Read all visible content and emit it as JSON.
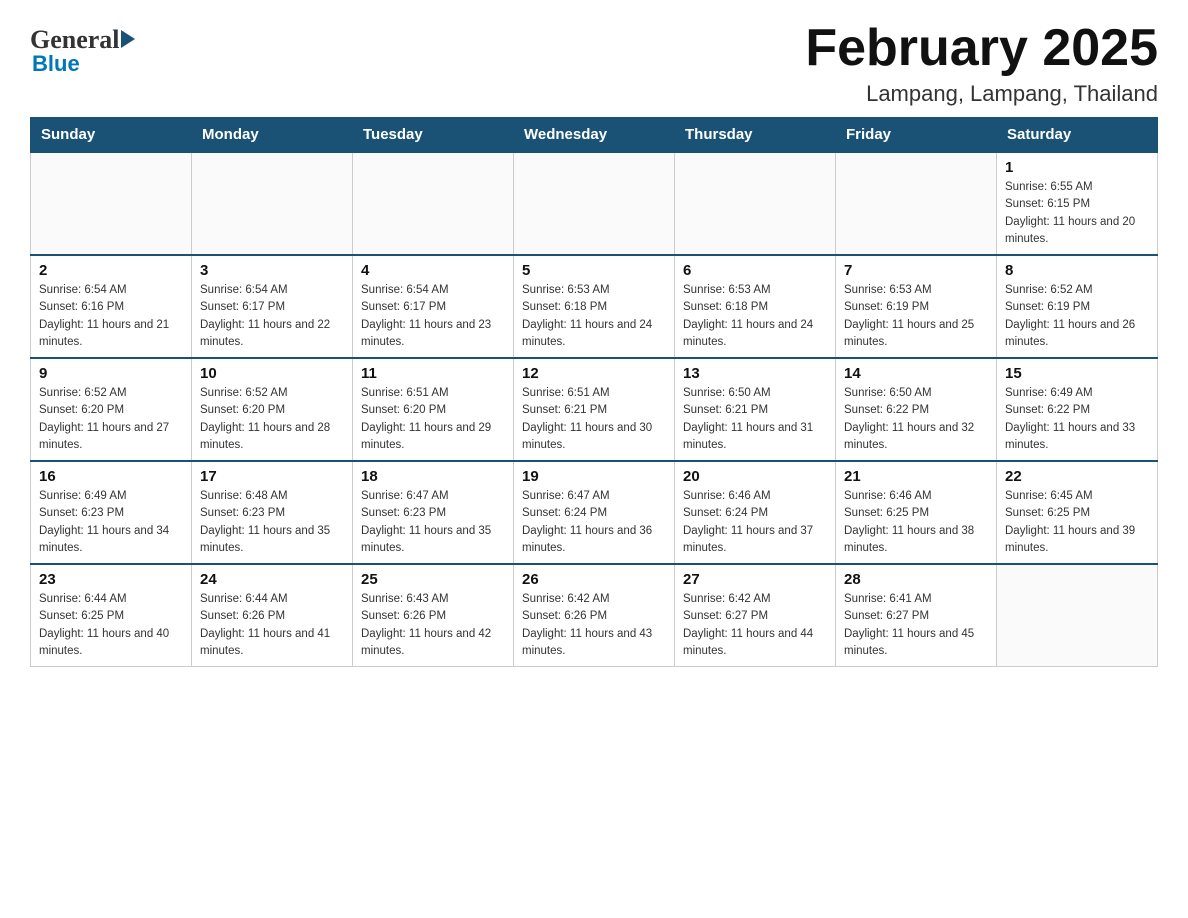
{
  "logo": {
    "general": "General",
    "blue": "Blue"
  },
  "title": "February 2025",
  "subtitle": "Lampang, Lampang, Thailand",
  "weekdays": [
    "Sunday",
    "Monday",
    "Tuesday",
    "Wednesday",
    "Thursday",
    "Friday",
    "Saturday"
  ],
  "weeks": [
    [
      {
        "day": "",
        "info": ""
      },
      {
        "day": "",
        "info": ""
      },
      {
        "day": "",
        "info": ""
      },
      {
        "day": "",
        "info": ""
      },
      {
        "day": "",
        "info": ""
      },
      {
        "day": "",
        "info": ""
      },
      {
        "day": "1",
        "info": "Sunrise: 6:55 AM\nSunset: 6:15 PM\nDaylight: 11 hours and 20 minutes."
      }
    ],
    [
      {
        "day": "2",
        "info": "Sunrise: 6:54 AM\nSunset: 6:16 PM\nDaylight: 11 hours and 21 minutes."
      },
      {
        "day": "3",
        "info": "Sunrise: 6:54 AM\nSunset: 6:17 PM\nDaylight: 11 hours and 22 minutes."
      },
      {
        "day": "4",
        "info": "Sunrise: 6:54 AM\nSunset: 6:17 PM\nDaylight: 11 hours and 23 minutes."
      },
      {
        "day": "5",
        "info": "Sunrise: 6:53 AM\nSunset: 6:18 PM\nDaylight: 11 hours and 24 minutes."
      },
      {
        "day": "6",
        "info": "Sunrise: 6:53 AM\nSunset: 6:18 PM\nDaylight: 11 hours and 24 minutes."
      },
      {
        "day": "7",
        "info": "Sunrise: 6:53 AM\nSunset: 6:19 PM\nDaylight: 11 hours and 25 minutes."
      },
      {
        "day": "8",
        "info": "Sunrise: 6:52 AM\nSunset: 6:19 PM\nDaylight: 11 hours and 26 minutes."
      }
    ],
    [
      {
        "day": "9",
        "info": "Sunrise: 6:52 AM\nSunset: 6:20 PM\nDaylight: 11 hours and 27 minutes."
      },
      {
        "day": "10",
        "info": "Sunrise: 6:52 AM\nSunset: 6:20 PM\nDaylight: 11 hours and 28 minutes."
      },
      {
        "day": "11",
        "info": "Sunrise: 6:51 AM\nSunset: 6:20 PM\nDaylight: 11 hours and 29 minutes."
      },
      {
        "day": "12",
        "info": "Sunrise: 6:51 AM\nSunset: 6:21 PM\nDaylight: 11 hours and 30 minutes."
      },
      {
        "day": "13",
        "info": "Sunrise: 6:50 AM\nSunset: 6:21 PM\nDaylight: 11 hours and 31 minutes."
      },
      {
        "day": "14",
        "info": "Sunrise: 6:50 AM\nSunset: 6:22 PM\nDaylight: 11 hours and 32 minutes."
      },
      {
        "day": "15",
        "info": "Sunrise: 6:49 AM\nSunset: 6:22 PM\nDaylight: 11 hours and 33 minutes."
      }
    ],
    [
      {
        "day": "16",
        "info": "Sunrise: 6:49 AM\nSunset: 6:23 PM\nDaylight: 11 hours and 34 minutes."
      },
      {
        "day": "17",
        "info": "Sunrise: 6:48 AM\nSunset: 6:23 PM\nDaylight: 11 hours and 35 minutes."
      },
      {
        "day": "18",
        "info": "Sunrise: 6:47 AM\nSunset: 6:23 PM\nDaylight: 11 hours and 35 minutes."
      },
      {
        "day": "19",
        "info": "Sunrise: 6:47 AM\nSunset: 6:24 PM\nDaylight: 11 hours and 36 minutes."
      },
      {
        "day": "20",
        "info": "Sunrise: 6:46 AM\nSunset: 6:24 PM\nDaylight: 11 hours and 37 minutes."
      },
      {
        "day": "21",
        "info": "Sunrise: 6:46 AM\nSunset: 6:25 PM\nDaylight: 11 hours and 38 minutes."
      },
      {
        "day": "22",
        "info": "Sunrise: 6:45 AM\nSunset: 6:25 PM\nDaylight: 11 hours and 39 minutes."
      }
    ],
    [
      {
        "day": "23",
        "info": "Sunrise: 6:44 AM\nSunset: 6:25 PM\nDaylight: 11 hours and 40 minutes."
      },
      {
        "day": "24",
        "info": "Sunrise: 6:44 AM\nSunset: 6:26 PM\nDaylight: 11 hours and 41 minutes."
      },
      {
        "day": "25",
        "info": "Sunrise: 6:43 AM\nSunset: 6:26 PM\nDaylight: 11 hours and 42 minutes."
      },
      {
        "day": "26",
        "info": "Sunrise: 6:42 AM\nSunset: 6:26 PM\nDaylight: 11 hours and 43 minutes."
      },
      {
        "day": "27",
        "info": "Sunrise: 6:42 AM\nSunset: 6:27 PM\nDaylight: 11 hours and 44 minutes."
      },
      {
        "day": "28",
        "info": "Sunrise: 6:41 AM\nSunset: 6:27 PM\nDaylight: 11 hours and 45 minutes."
      },
      {
        "day": "",
        "info": ""
      }
    ]
  ]
}
